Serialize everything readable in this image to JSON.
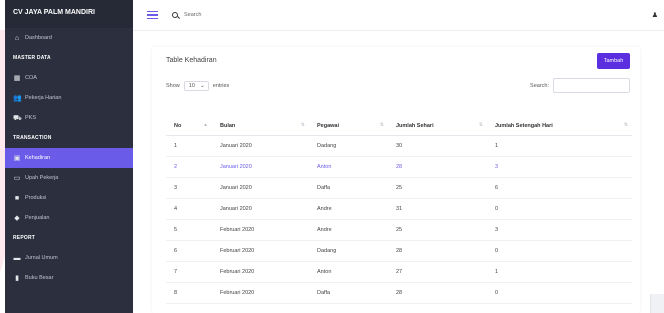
{
  "brand": "CV JAYA PALM MANDIRI",
  "sidebar": {
    "items": [
      {
        "type": "item",
        "label": "Dashboard",
        "icon": "dashboard-icon",
        "glyph": "⌂"
      },
      {
        "type": "head",
        "label": "MASTER DATA"
      },
      {
        "type": "item",
        "label": "COA",
        "icon": "grid-icon",
        "glyph": "▦"
      },
      {
        "type": "item",
        "label": "Pekerja Harian",
        "icon": "users-icon",
        "glyph": "👥"
      },
      {
        "type": "item",
        "label": "PKS",
        "icon": "truck-icon",
        "glyph": "⛟"
      },
      {
        "type": "head",
        "label": "TRANSACTION"
      },
      {
        "type": "item",
        "label": "Kehadiran",
        "icon": "calendar-icon",
        "glyph": "▣",
        "active": true
      },
      {
        "type": "item",
        "label": "Upah Pekerja",
        "icon": "money-icon",
        "glyph": "▭"
      },
      {
        "type": "item",
        "label": "Produksi",
        "icon": "box-icon",
        "glyph": "■"
      },
      {
        "type": "item",
        "label": "Penjualan",
        "icon": "tag-icon",
        "glyph": "◆"
      },
      {
        "type": "head",
        "label": "REPORT"
      },
      {
        "type": "item",
        "label": "Jurnal Umum",
        "icon": "folder-icon",
        "glyph": "▬"
      },
      {
        "type": "item",
        "label": "Buku Besar",
        "icon": "book-icon",
        "glyph": "▮"
      }
    ]
  },
  "topbar": {
    "search_label": "Search"
  },
  "card": {
    "title": "Table Kehadiran",
    "add_button": "Tambah",
    "show_label": "Show",
    "entries_value": "10",
    "entries_label": "entries",
    "search_label": "Search:"
  },
  "table": {
    "headers": [
      "No",
      "Bulan",
      "Pegawai",
      "Jumlah Sehari",
      "Jumlah Setengah Hari"
    ],
    "rows": [
      [
        "1",
        "Januari 2020",
        "Dadang",
        "30",
        "1"
      ],
      [
        "2",
        "Januari 2020",
        "Anton",
        "28",
        "3"
      ],
      [
        "3",
        "Januari 2020",
        "Daffa",
        "25",
        "6"
      ],
      [
        "4",
        "Januari 2020",
        "Andre",
        "31",
        "0"
      ],
      [
        "5",
        "Februari 2020",
        "Andre",
        "25",
        "3"
      ],
      [
        "6",
        "Februari 2020",
        "Dadang",
        "28",
        "0"
      ],
      [
        "7",
        "Februari 2020",
        "Anton",
        "27",
        "1"
      ],
      [
        "8",
        "Februari 2020",
        "Daffa",
        "28",
        "0"
      ]
    ],
    "highlight_row": 1
  },
  "colors": {
    "accent": "#6a5be8",
    "button": "#5b2ee0",
    "sidebar": "#2b2f3e"
  }
}
